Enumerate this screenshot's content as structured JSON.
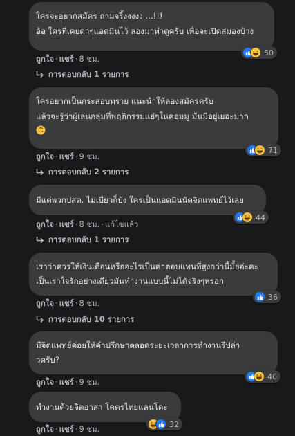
{
  "comments": [
    {
      "lines": [
        "ใครจะอยากสมัคร ถามจริ้งงงงง ...!!!",
        "อ้อ ใครที่เคยด่าๆแอดมินไว้ ลองมาทำดูครับ เพื่อจะเปิดสมองบ้าง"
      ],
      "reaction_count": "50",
      "reactions": [
        "like",
        "haha"
      ],
      "like_label": "ถูกใจ",
      "share_label": "แชร์",
      "time": "8 ชม.",
      "edited": "",
      "replies": "การตอบกลับ 1 รายการ"
    },
    {
      "lines": [
        "ใครอยากเป็นกระสอบทราย แนะนำให้ลองสมัครครับ",
        "แล้วจะรู้ว่าผู้เล่นกลุ่มที่พฤติกรรมแย่ๆในคอมมู มันมีอยู่เยอะมาก"
      ],
      "trailing_emoji": "upside-down-face",
      "reaction_count": "71",
      "reactions": [
        "like",
        "haha"
      ],
      "like_label": "ถูกใจ",
      "share_label": "แชร์",
      "time": "9 ชม.",
      "edited": "",
      "replies": "การตอบกลับ 2 รายการ"
    },
    {
      "lines": [
        "มีแต่พวกปสด. ไม่เบียวก็บ้ง ใครเป็นแอดมินนัดจิตแพทย์ไว้เลย"
      ],
      "reaction_count": "44",
      "reactions": [
        "like",
        "haha"
      ],
      "like_label": "ถูกใจ",
      "share_label": "แชร์",
      "time": "8 ชม.",
      "edited": "แก้ไขแล้ว",
      "replies": "การตอบกลับ 1 รายการ"
    },
    {
      "lines": [
        "เราว่าควรให้เงินเดือนหรืออะไรเป็นค่าตอบแทนที่สูงกว่านี้มั้ยอ่ะคะ",
        "เป็นเราใจรักอย่างเดียวมันทำงานแบบนี้ไม่ได้จริงๆหรอก"
      ],
      "reaction_count": "36",
      "reactions": [
        "like"
      ],
      "like_label": "ถูกใจ",
      "share_label": "แชร์",
      "time": "8 ชม.",
      "edited": "",
      "replies": "การตอบกลับ 10 รายการ"
    },
    {
      "lines": [
        "มีจิตแพทย์ค่อยให้คำปรึกษาตลอดระยะเวลาการทำงานรึปล่า",
        "วครับ?"
      ],
      "reaction_count": "46",
      "reactions": [
        "like",
        "haha"
      ],
      "like_label": "ถูกใจ",
      "share_label": "แชร์",
      "time": "9 ชม.",
      "edited": "",
      "replies": ""
    },
    {
      "lines": [
        "ทำงานด้วยจิตอาสา โคตรไทยแลนโดะ"
      ],
      "reaction_count": "32",
      "reactions": [
        "haha",
        "like"
      ],
      "like_label": "ถูกใจ",
      "share_label": "แชร์",
      "time": "9 ชม.",
      "edited": "",
      "replies": ""
    }
  ]
}
